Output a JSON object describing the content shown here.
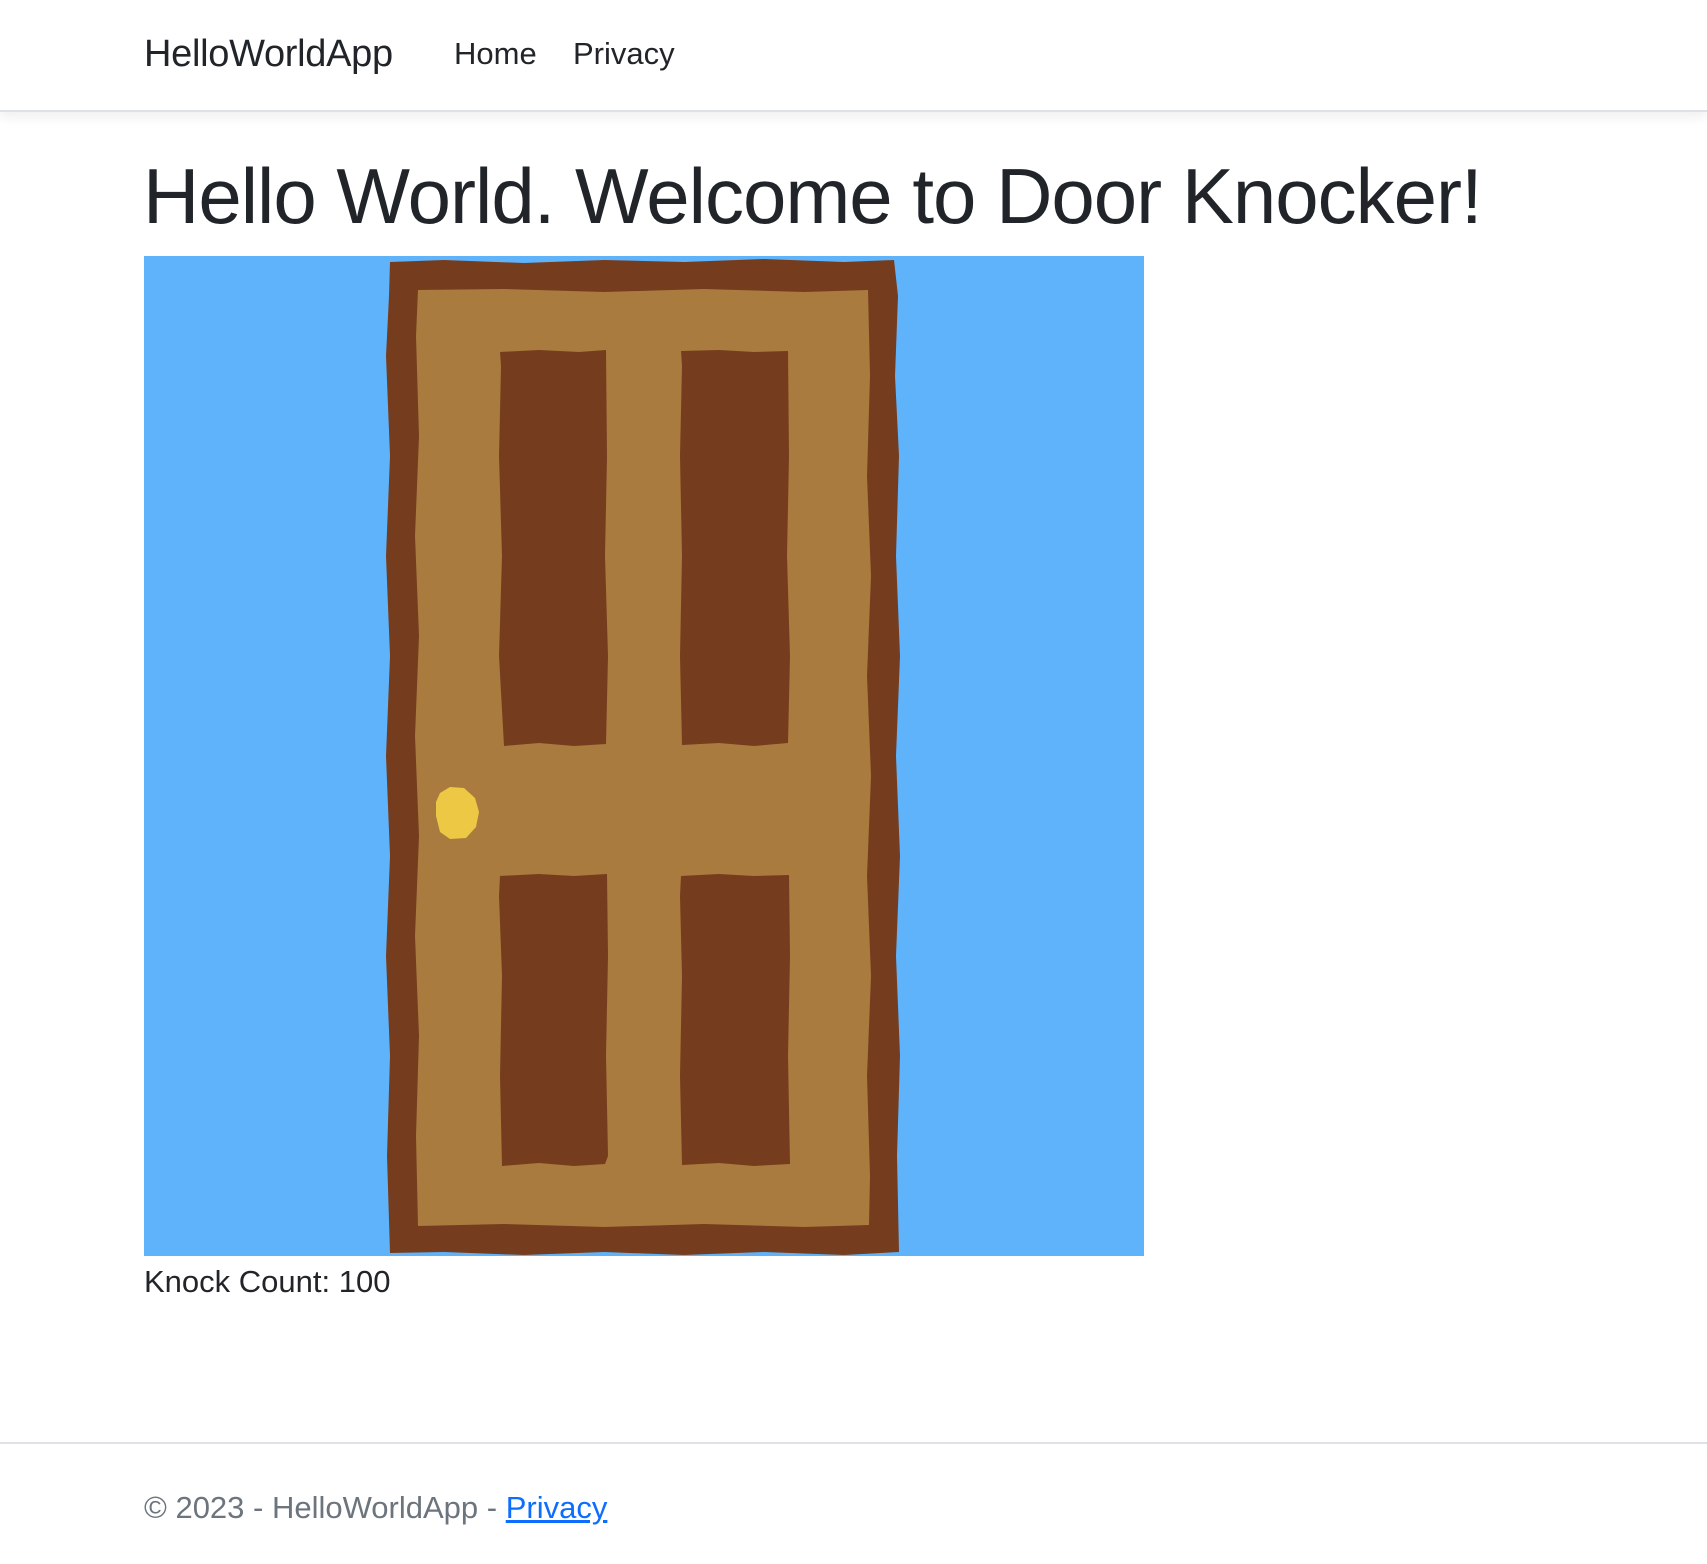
{
  "navbar": {
    "brand": "HelloWorldApp",
    "links": [
      {
        "label": "Home"
      },
      {
        "label": "Privacy"
      }
    ]
  },
  "main": {
    "title": "Hello World. Welcome to Door Knocker!",
    "door_image": {
      "icon": "door-icon",
      "colors": {
        "sky": "#5fb3fa",
        "frame": "#763c1e",
        "door": "#a97b3e",
        "panel": "#763c1e",
        "knob": "#ecc844"
      }
    },
    "knock_label": "Knock Count:",
    "knock_count": "100"
  },
  "footer": {
    "copyright": "© 2023 - HelloWorldApp -",
    "privacy_link": "Privacy"
  },
  "colors": {
    "text": "#212529",
    "muted": "#6c757d",
    "link": "#0d6efd",
    "border": "#dee2e6"
  }
}
